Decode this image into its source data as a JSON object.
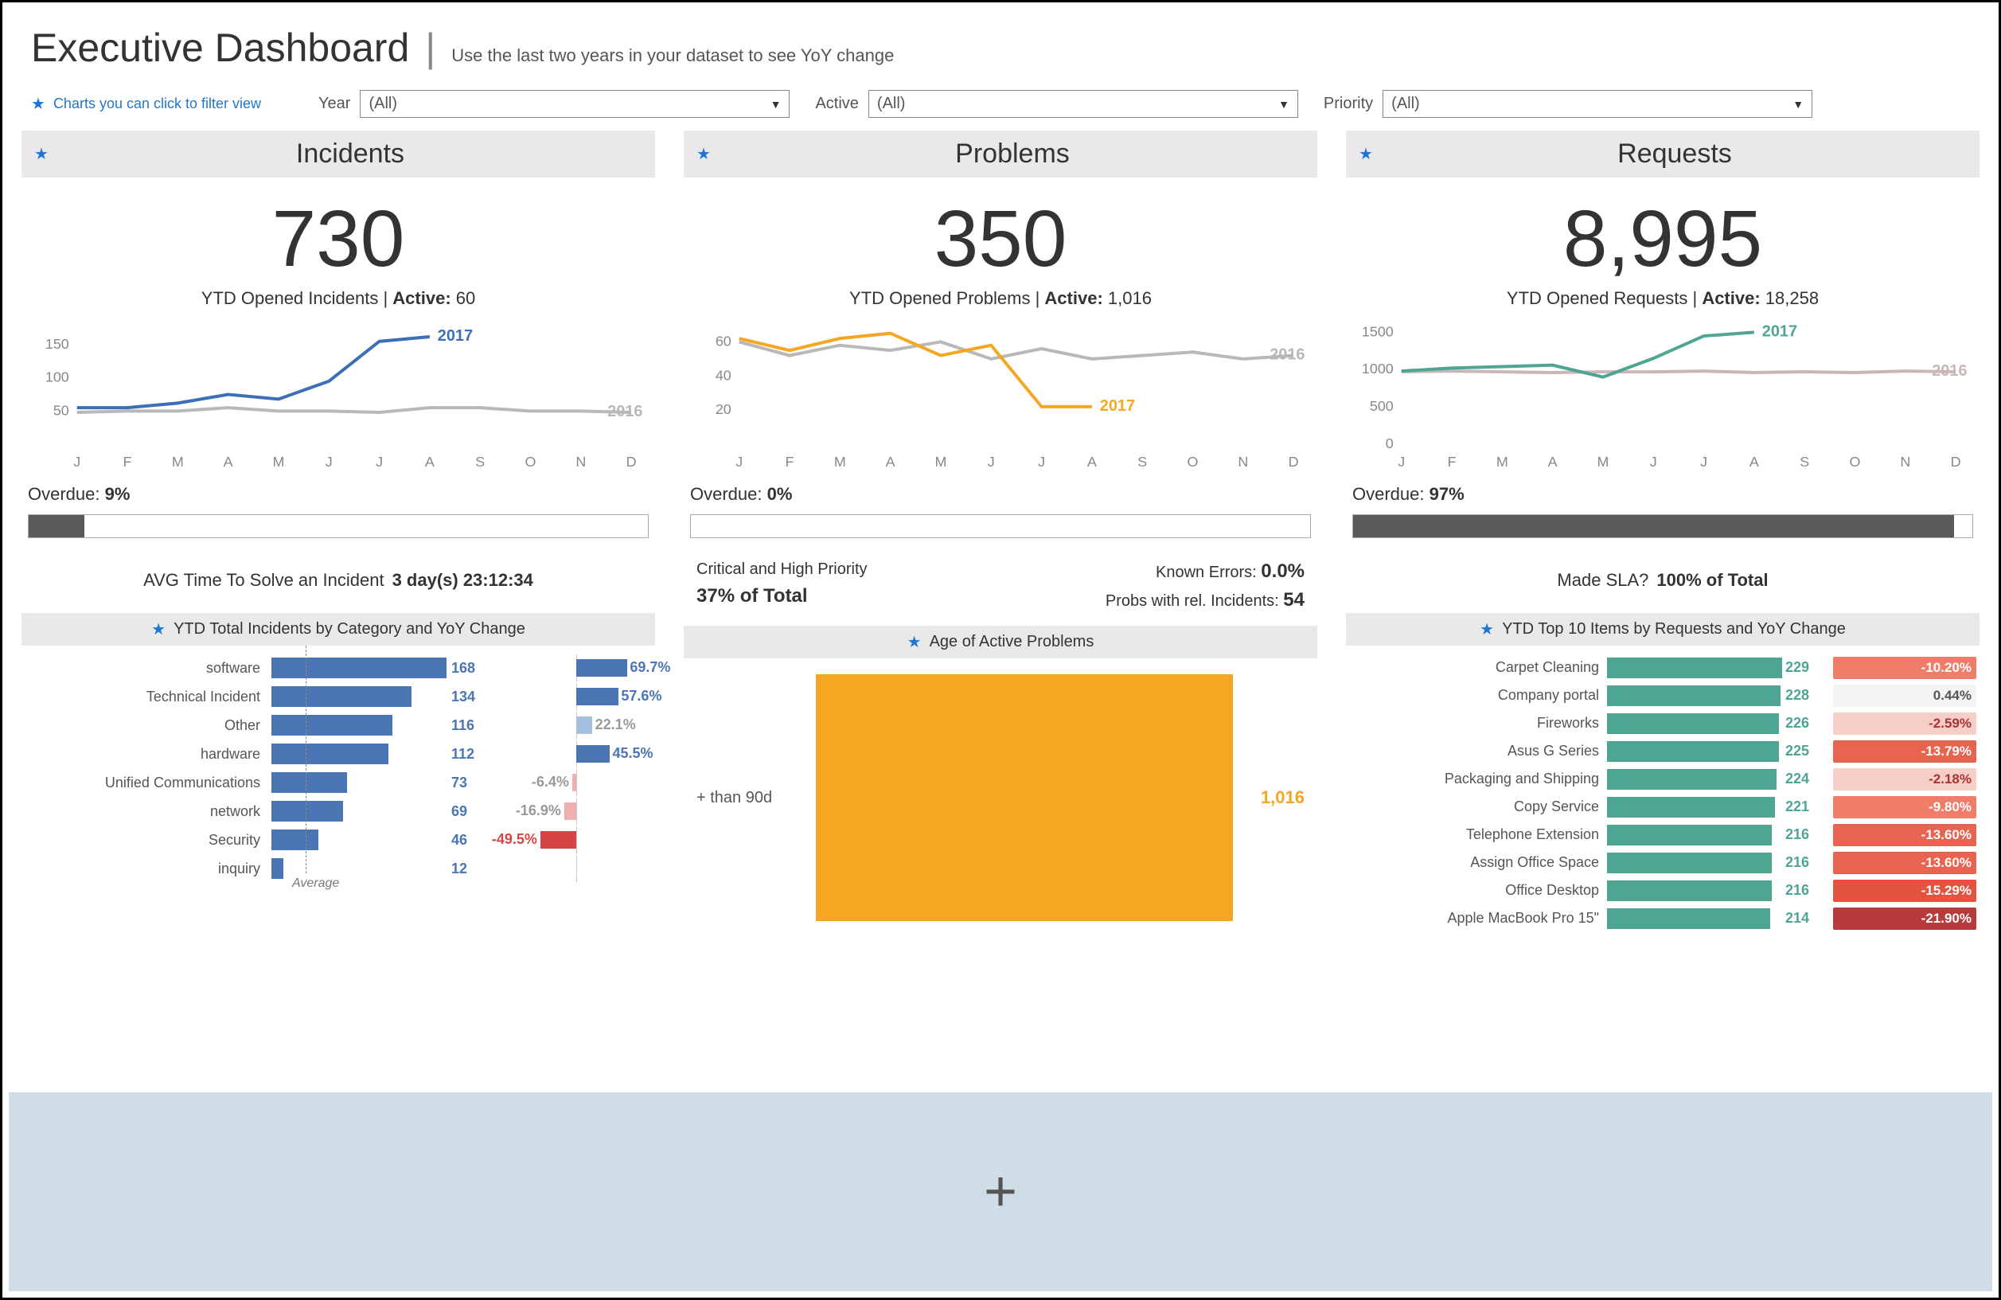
{
  "header": {
    "title": "Executive Dashboard",
    "subtitle": "Use the last two years in your dataset to see YoY change"
  },
  "legend_hint": "Charts you can click to filter view",
  "filters": {
    "year": {
      "label": "Year",
      "value": "(All)"
    },
    "active": {
      "label": "Active",
      "value": "(All)"
    },
    "priority": {
      "label": "Priority",
      "value": "(All)"
    }
  },
  "panels": {
    "incidents": {
      "title": "Incidents",
      "total": "730",
      "sub_prefix": "YTD Opened Incidents | ",
      "sub_bold": "Active:",
      "sub_val": " 60",
      "overdue_label": "Overdue:",
      "overdue_val": "9%",
      "avg_label": "AVG Time To Solve an Incident",
      "avg_val": "3 day(s) 23:12:34",
      "sub_chart_title": "YTD Total Incidents by Category and YoY Change",
      "avg_marker": "Average"
    },
    "problems": {
      "title": "Problems",
      "total": "350",
      "sub_prefix": "YTD Opened Problems | ",
      "sub_bold": "Active:",
      "sub_val": " 1,016",
      "overdue_label": "Overdue:",
      "overdue_val": "0%",
      "crit_label": "Critical and High Priority",
      "crit_val": "37% of Total",
      "known_label": "Known Errors:",
      "known_val": "0.0%",
      "rel_label": "Probs with rel. Incidents:",
      "rel_val": "54",
      "sub_chart_title": "Age of Active Problems",
      "age_label": "+ than 90d",
      "age_val": "1,016"
    },
    "requests": {
      "title": "Requests",
      "total": "8,995",
      "sub_prefix": "YTD Opened Requests | ",
      "sub_bold": "Active:",
      "sub_val": " 18,258",
      "overdue_label": "Overdue:",
      "overdue_val": "97%",
      "sla_label": "Made SLA?",
      "sla_val": "100% of Total",
      "sub_chart_title": "YTD Top 10 Items by Requests and YoY Change"
    }
  },
  "chart_data": [
    {
      "id": "incidents_trend",
      "type": "line",
      "title": "YTD Opened Incidents",
      "xlabel": "",
      "ylabel": "",
      "categories": [
        "J",
        "F",
        "M",
        "A",
        "M",
        "J",
        "J",
        "A",
        "S",
        "O",
        "N",
        "D"
      ],
      "series": [
        {
          "name": "2017",
          "values": [
            55,
            55,
            62,
            75,
            68,
            95,
            155,
            162,
            null,
            null,
            null,
            null
          ],
          "color": "#3b6fb6"
        },
        {
          "name": "2016",
          "values": [
            48,
            50,
            50,
            55,
            50,
            50,
            48,
            55,
            55,
            50,
            50,
            48
          ],
          "color": "#b8b8b8"
        }
      ],
      "ylim": [
        0,
        180
      ],
      "y_ticks": [
        50,
        100,
        150
      ]
    },
    {
      "id": "problems_trend",
      "type": "line",
      "title": "YTD Opened Problems",
      "xlabel": "",
      "ylabel": "",
      "categories": [
        "J",
        "F",
        "M",
        "A",
        "M",
        "J",
        "J",
        "A",
        "S",
        "O",
        "N",
        "D"
      ],
      "series": [
        {
          "name": "2017",
          "values": [
            62,
            55,
            62,
            65,
            52,
            58,
            22,
            22,
            null,
            null,
            null,
            null
          ],
          "color": "#f5a623"
        },
        {
          "name": "2016",
          "values": [
            60,
            52,
            58,
            55,
            60,
            50,
            56,
            50,
            52,
            54,
            50,
            52
          ],
          "color": "#b8b8b8"
        }
      ],
      "ylim": [
        0,
        70
      ],
      "y_ticks": [
        20,
        40,
        60
      ]
    },
    {
      "id": "requests_trend",
      "type": "line",
      "title": "YTD Opened Requests",
      "xlabel": "",
      "ylabel": "",
      "categories": [
        "J",
        "F",
        "M",
        "A",
        "M",
        "J",
        "J",
        "A",
        "S",
        "O",
        "N",
        "D"
      ],
      "series": [
        {
          "name": "2017",
          "values": [
            980,
            1020,
            1040,
            1060,
            900,
            1150,
            1450,
            1500,
            null,
            null,
            null,
            null
          ],
          "color": "#4fa594"
        },
        {
          "name": "2016",
          "values": [
            970,
            980,
            970,
            960,
            970,
            970,
            980,
            960,
            970,
            960,
            980,
            970
          ],
          "color": "#c9b7b7"
        }
      ],
      "ylim": [
        0,
        1600
      ],
      "y_ticks": [
        0,
        500,
        1000,
        1500
      ]
    },
    {
      "id": "incidents_category",
      "type": "bar",
      "title": "YTD Total Incidents by Category and YoY Change",
      "categories": [
        "software",
        "Technical Incident",
        "Other",
        "hardware",
        "Unified Communications",
        "network",
        "Security",
        "inquiry"
      ],
      "series": [
        {
          "name": "Count",
          "values": [
            168,
            134,
            116,
            112,
            73,
            69,
            46,
            12
          ]
        },
        {
          "name": "YoY%",
          "values": [
            69.7,
            57.6,
            22.1,
            45.5,
            -6.4,
            -16.9,
            -49.5,
            null
          ]
        }
      ],
      "average_marker": 91
    },
    {
      "id": "problems_age",
      "type": "bar",
      "title": "Age of Active Problems",
      "categories": [
        "+ than 90d"
      ],
      "values": [
        1016
      ]
    },
    {
      "id": "requests_top10",
      "type": "bar",
      "title": "YTD Top 10 Items by Requests and YoY Change",
      "categories": [
        "Carpet Cleaning",
        "Company portal",
        "Fireworks",
        "Asus G Series",
        "Packaging and Shipping",
        "Copy Service",
        "Telephone Extension",
        "Assign Office Space",
        "Office Desktop",
        "Apple MacBook Pro 15\""
      ],
      "series": [
        {
          "name": "Count",
          "values": [
            229,
            228,
            226,
            225,
            224,
            221,
            216,
            216,
            216,
            214
          ]
        },
        {
          "name": "YoY%",
          "values": [
            -10.2,
            0.44,
            -2.59,
            -13.79,
            -2.18,
            -9.8,
            -13.6,
            -13.6,
            -15.29,
            -21.9
          ]
        }
      ]
    }
  ],
  "inc_rows": [
    {
      "label": "software",
      "val": "168",
      "w": 100,
      "yoy": "69.7%",
      "yw": 70,
      "pos": true,
      "light": false
    },
    {
      "label": "Technical Incident",
      "val": "134",
      "w": 80,
      "yoy": "57.6%",
      "yw": 58,
      "pos": true,
      "light": false
    },
    {
      "label": "Other",
      "val": "116",
      "w": 69,
      "yoy": "22.1%",
      "yw": 22,
      "pos": true,
      "light": true
    },
    {
      "label": "hardware",
      "val": "112",
      "w": 67,
      "yoy": "45.5%",
      "yw": 46,
      "pos": true,
      "light": false
    },
    {
      "label": "Unified Communications",
      "val": "73",
      "w": 43,
      "yoy": "-6.4%",
      "yw": 6,
      "pos": false,
      "light": true
    },
    {
      "label": "network",
      "val": "69",
      "w": 41,
      "yoy": "-16.9%",
      "yw": 17,
      "pos": false,
      "light": true
    },
    {
      "label": "Security",
      "val": "46",
      "w": 27,
      "yoy": "-49.5%",
      "yw": 50,
      "pos": false,
      "light": false
    },
    {
      "label": "inquiry",
      "val": "12",
      "w": 7,
      "yoy": "",
      "yw": 0,
      "pos": true,
      "light": true
    }
  ],
  "req_rows": [
    {
      "label": "Carpet Cleaning",
      "val": "229",
      "w": 100,
      "yoy": "-10.20%",
      "color": "#ef7d6a"
    },
    {
      "label": "Company portal",
      "val": "228",
      "w": 99,
      "yoy": "0.44%",
      "color": "#f4f4f4",
      "txt": "#555"
    },
    {
      "label": "Fireworks",
      "val": "226",
      "w": 98,
      "yoy": "-2.59%",
      "color": "#f5cfc7",
      "txt": "#a33"
    },
    {
      "label": "Asus G Series",
      "val": "225",
      "w": 98,
      "yoy": "-13.79%",
      "color": "#e86450"
    },
    {
      "label": "Packaging and Shipping",
      "val": "224",
      "w": 97,
      "yoy": "-2.18%",
      "color": "#f5cfc7",
      "txt": "#a33"
    },
    {
      "label": "Copy Service",
      "val": "221",
      "w": 96,
      "yoy": "-9.80%",
      "color": "#ef7d6a"
    },
    {
      "label": "Telephone Extension",
      "val": "216",
      "w": 94,
      "yoy": "-13.60%",
      "color": "#e86450"
    },
    {
      "label": "Assign Office Space",
      "val": "216",
      "w": 94,
      "yoy": "-13.60%",
      "color": "#e86450"
    },
    {
      "label": "Office Desktop",
      "val": "216",
      "w": 94,
      "yoy": "-15.29%",
      "color": "#e25440"
    },
    {
      "label": "Apple MacBook Pro 15\"",
      "val": "214",
      "w": 93,
      "yoy": "-21.90%",
      "color": "#b83b3b"
    }
  ]
}
